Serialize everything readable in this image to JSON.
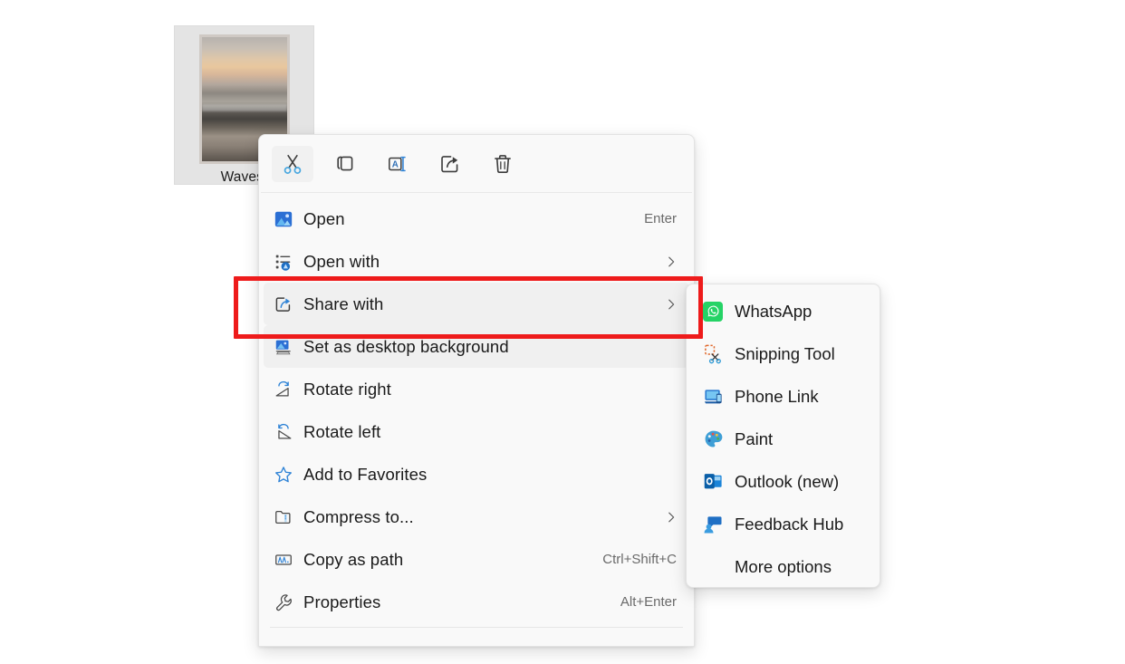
{
  "desktop": {
    "file_label": "Waves."
  },
  "context_menu": {
    "toolbar": [
      {
        "name": "cut",
        "label": "Cut"
      },
      {
        "name": "copy",
        "label": "Copy"
      },
      {
        "name": "rename",
        "label": "Rename"
      },
      {
        "name": "share",
        "label": "Share"
      },
      {
        "name": "delete",
        "label": "Delete"
      }
    ],
    "items": [
      {
        "label": "Open",
        "accel": "Enter",
        "chevron": false,
        "hovered": false
      },
      {
        "label": "Open with",
        "accel": "",
        "chevron": true,
        "hovered": false
      },
      {
        "label": "Share with",
        "accel": "",
        "chevron": true,
        "hovered": true
      },
      {
        "label": "Set as desktop background",
        "accel": "",
        "chevron": false,
        "hovered": true
      },
      {
        "label": "Rotate right",
        "accel": "",
        "chevron": false,
        "hovered": false
      },
      {
        "label": "Rotate left",
        "accel": "",
        "chevron": false,
        "hovered": false
      },
      {
        "label": "Add to Favorites",
        "accel": "",
        "chevron": false,
        "hovered": false
      },
      {
        "label": "Compress to...",
        "accel": "",
        "chevron": true,
        "hovered": false
      },
      {
        "label": "Copy as path",
        "accel": "Ctrl+Shift+C",
        "chevron": false,
        "hovered": false
      },
      {
        "label": "Properties",
        "accel": "Alt+Enter",
        "chevron": false,
        "hovered": false
      }
    ]
  },
  "share_submenu": {
    "items": [
      {
        "label": "WhatsApp",
        "icon": "whatsapp-icon"
      },
      {
        "label": "Snipping Tool",
        "icon": "snipping-tool-icon"
      },
      {
        "label": "Phone Link",
        "icon": "phone-link-icon"
      },
      {
        "label": "Paint",
        "icon": "paint-icon"
      },
      {
        "label": "Outlook (new)",
        "icon": "outlook-icon"
      },
      {
        "label": "Feedback Hub",
        "icon": "feedback-hub-icon"
      },
      {
        "label": "More options",
        "icon": "none"
      }
    ]
  },
  "annotation": {
    "highlight_color": "#ee1b1b",
    "target": "Share with"
  }
}
